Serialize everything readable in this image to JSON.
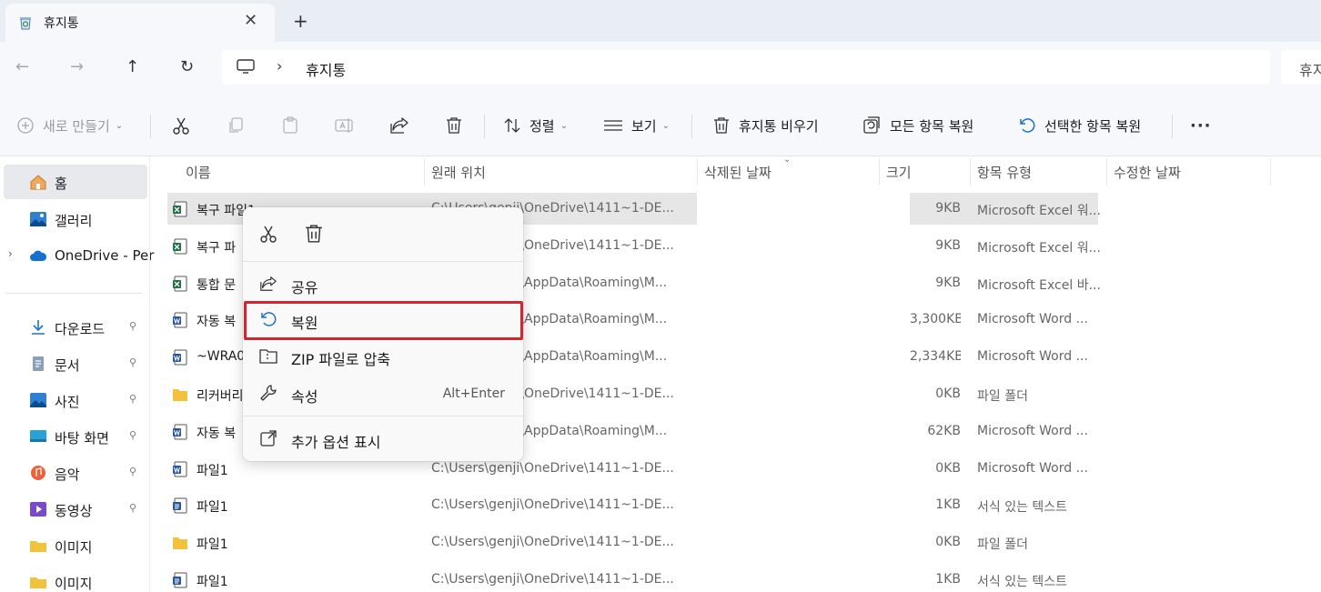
{
  "window": {
    "tab_title": "휴지통",
    "new_tab": "+",
    "close_tab": "✕"
  },
  "nav": {
    "back": "←",
    "forward": "→",
    "up": "↑",
    "refresh": "↻",
    "breadcrumb_sep": "›",
    "breadcrumb": "휴지통",
    "search_placeholder": "휴지"
  },
  "toolbar": {
    "new_label": "새로 만들기",
    "sort_label": "정렬",
    "view_label": "보기",
    "empty_label": "휴지통 비우기",
    "restore_all_label": "모든 항목 복원",
    "restore_selected_label": "선택한 항목 복원",
    "more_label": "···"
  },
  "sidebar": {
    "items": [
      {
        "label": "홈",
        "icon": "home-icon"
      },
      {
        "label": "갤러리",
        "icon": "gallery-icon"
      },
      {
        "label": "OneDrive - Per",
        "icon": "onedrive-icon"
      },
      {
        "label": "다운로드",
        "icon": "download-icon"
      },
      {
        "label": "문서",
        "icon": "documents-icon"
      },
      {
        "label": "사진",
        "icon": "pictures-icon"
      },
      {
        "label": "바탕 화면",
        "icon": "desktop-icon"
      },
      {
        "label": "음악",
        "icon": "music-icon"
      },
      {
        "label": "동영상",
        "icon": "videos-icon"
      },
      {
        "label": "이미지",
        "icon": "folder-icon"
      },
      {
        "label": "이미지",
        "icon": "folder-icon"
      }
    ],
    "pin_glyph": "📌",
    "expand_glyph": "›"
  },
  "columns": {
    "name": "이름",
    "location": "원래 위치",
    "deleted": "삭제된 날짜",
    "size": "크기",
    "type": "항목 유형",
    "modified": "수정한 날짜"
  },
  "files": [
    {
      "name": "복구 파일1",
      "location": "C:\\Users\\genji\\OneDrive\\1411~1-DE...",
      "size": "9KB",
      "type": "Microsoft Excel 워...",
      "icon": "excel-file-icon"
    },
    {
      "name": "복구 파",
      "location": "C:\\Users\\genji\\OneDrive\\1411~1-DE...",
      "size": "9KB",
      "type": "Microsoft Excel 워...",
      "icon": "excel-file-icon"
    },
    {
      "name": "통합 문",
      "location": "C:\\Users\\genji\\AppData\\Roaming\\M...",
      "size": "9KB",
      "type": "Microsoft Excel 바...",
      "icon": "excel-file-icon"
    },
    {
      "name": "자동 복",
      "location": "C:\\Users\\genji\\AppData\\Roaming\\M...",
      "size": "3,300KB",
      "type": "Microsoft Word ...",
      "icon": "word-file-icon"
    },
    {
      "name": "~WRA0",
      "location": "C:\\Users\\genji\\AppData\\Roaming\\M...",
      "size": "2,334KB",
      "type": "Microsoft Word ...",
      "icon": "word-file-icon"
    },
    {
      "name": "리커버리",
      "location": "C:\\Users\\genji\\OneDrive\\1411~1-DE...",
      "size": "0KB",
      "type": "파일 폴더",
      "icon": "folder-icon"
    },
    {
      "name": "자동 복",
      "location": "C:\\Users\\genji\\AppData\\Roaming\\M...",
      "size": "62KB",
      "type": "Microsoft Word ...",
      "icon": "word-file-icon"
    },
    {
      "name": "파일1",
      "location": "C:\\Users\\genji\\OneDrive\\1411~1-DE...",
      "size": "0KB",
      "type": "Microsoft Word ...",
      "icon": "word-file-icon"
    },
    {
      "name": "파일1",
      "location": "C:\\Users\\genji\\OneDrive\\1411~1-DE...",
      "size": "1KB",
      "type": "서식 있는 텍스트",
      "icon": "rtf-file-icon"
    },
    {
      "name": "파일1",
      "location": "C:\\Users\\genji\\OneDrive\\1411~1-DE...",
      "size": "0KB",
      "type": "파일 폴더",
      "icon": "folder-icon"
    },
    {
      "name": "파일1",
      "location": "C:\\Users\\genji\\OneDrive\\1411~1-DE...",
      "size": "1KB",
      "type": "서식 있는 텍스트",
      "icon": "rtf-file-icon"
    }
  ],
  "context_menu": {
    "share": "공유",
    "restore": "복원",
    "zip": "ZIP 파일로 압축",
    "properties": "속성",
    "properties_shortcut": "Alt+Enter",
    "more_options": "추가 옵션 표시"
  },
  "colors": {
    "highlight_border": "#d5232f",
    "accent_blue": "#1a73c8",
    "excel_green": "#1e7145",
    "word_blue": "#2b579a",
    "folder_yellow": "#f2c23a"
  }
}
